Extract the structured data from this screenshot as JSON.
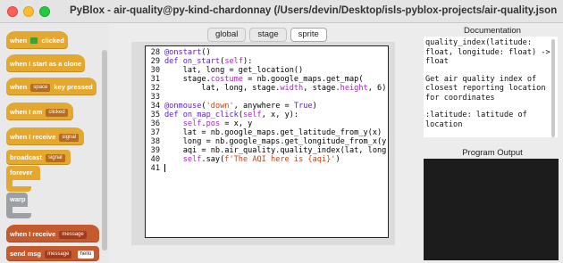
{
  "window": {
    "title": "PyBlox - air-quality@py-kind-chardonnay (/Users/devin/Desktop/isls-pyblox-projects/air-quality.json)"
  },
  "palette": {
    "when_clicked": [
      "when",
      "clicked"
    ],
    "start_clone": "when I start as a clone",
    "key_pressed": [
      "when",
      "space",
      "key pressed"
    ],
    "when_i_am": [
      "when I am",
      "clicked"
    ],
    "when_receive": [
      "when I receive",
      "signal"
    ],
    "broadcast": [
      "broadcast",
      "signal"
    ],
    "forever": "forever",
    "warp": "warp",
    "when_receive_msg": [
      "when I receive",
      "message"
    ],
    "send_msg": [
      "send msg",
      "message",
      "hello"
    ]
  },
  "tabs": [
    "global",
    "stage",
    "sprite"
  ],
  "active_tab": "sprite",
  "editor": {
    "line_numbers": [
      "28",
      "29",
      "30",
      "31",
      "32",
      "33",
      "34",
      "35",
      "36",
      "37",
      "38",
      "39",
      "40",
      "41"
    ]
  },
  "docs": {
    "title": "Documentation",
    "signature": "quality_index(latitude: float, longitude: float) -> float",
    "description": "Get air quality index of closest reporting location for coordinates",
    "param": ":latitude: latitude of location"
  },
  "output": {
    "title": "Program Output"
  },
  "colors": {
    "event_yellow": "#e5a82e",
    "control_orange": "#e08a2b",
    "message_red": "#c65a2f",
    "keyword_purple": "#5b24b5",
    "string_orange": "#b44a1e",
    "output_bg": "#1c1c1c"
  }
}
